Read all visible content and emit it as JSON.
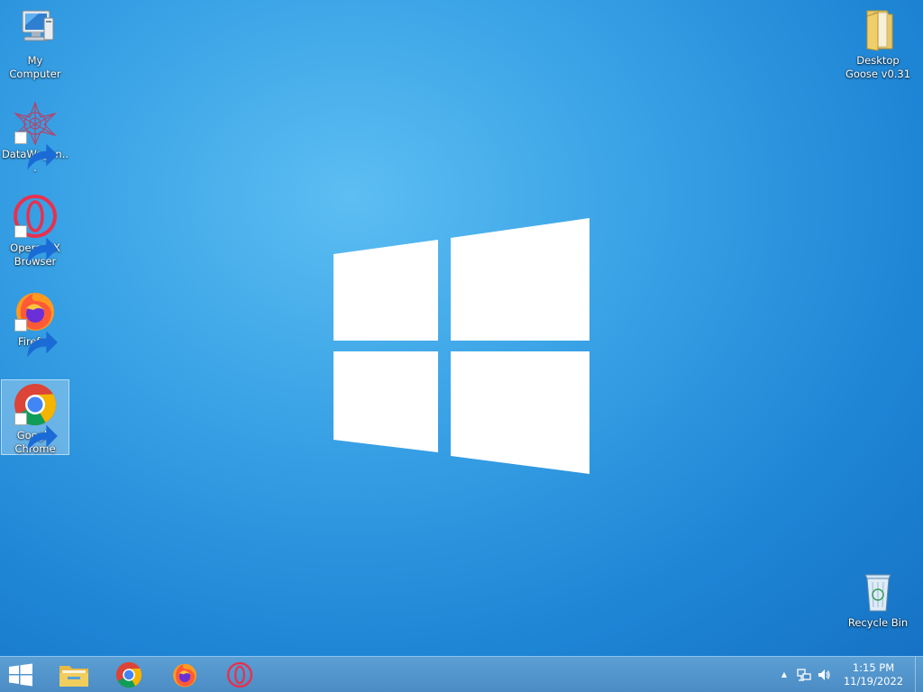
{
  "desktop": {
    "icons": [
      {
        "label": "My Computer",
        "icon": "computer-icon",
        "shortcut": false
      },
      {
        "label": "DataWagon...",
        "icon": "datawagon-icon",
        "shortcut": true
      },
      {
        "label": "Opera GX Browser",
        "icon": "opera-gx-icon",
        "shortcut": true
      },
      {
        "label": "Firefox",
        "icon": "firefox-icon",
        "shortcut": true
      },
      {
        "label": "Google Chrome",
        "icon": "chrome-icon",
        "shortcut": true,
        "selected": true
      },
      {
        "label": "Desktop Goose v0.31",
        "icon": "folder-icon",
        "shortcut": false
      },
      {
        "label": "Recycle Bin",
        "icon": "recycle-bin-icon",
        "shortcut": false
      }
    ]
  },
  "taskbar": {
    "items": [
      {
        "name": "start-button",
        "icon": "windows-logo-icon"
      },
      {
        "name": "file-explorer",
        "icon": "folder-icon"
      },
      {
        "name": "chrome",
        "icon": "chrome-icon"
      },
      {
        "name": "firefox",
        "icon": "firefox-icon"
      },
      {
        "name": "opera-gx",
        "icon": "opera-gx-icon"
      }
    ],
    "tray": {
      "overflow_symbol": "▲",
      "icons": [
        "network-icon",
        "volume-icon"
      ]
    },
    "clock": {
      "time": "1:15 PM",
      "date": "11/19/2022"
    }
  },
  "colors": {
    "desktop_background": "#2a93dd",
    "taskbar": "#5296cc",
    "selection": "#b4d7f0"
  }
}
